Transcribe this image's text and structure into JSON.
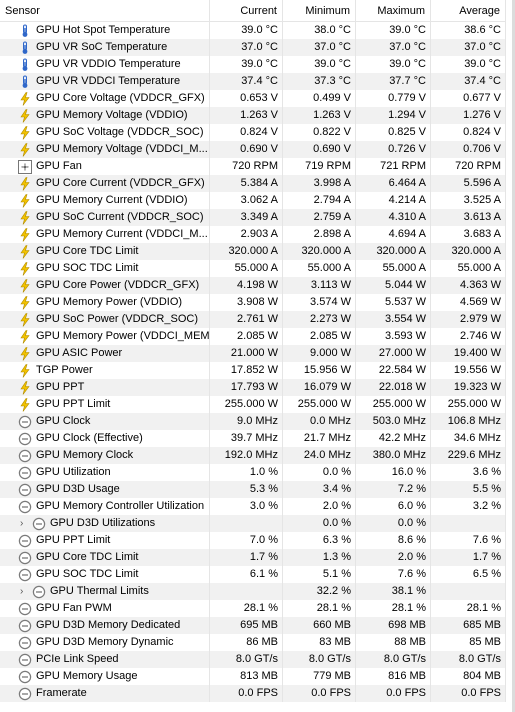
{
  "header": {
    "sensor": "Sensor",
    "current": "Current",
    "minimum": "Minimum",
    "maximum": "Maximum",
    "average": "Average"
  },
  "rows": [
    {
      "name": "GPU Hot Spot Temperature",
      "icon": "thermometer-icon",
      "current": "39.0 °C",
      "min": "38.0 °C",
      "max": "39.0 °C",
      "avg": "38.6 °C"
    },
    {
      "name": "GPU VR SoC Temperature",
      "icon": "thermometer-icon",
      "current": "37.0 °C",
      "min": "37.0 °C",
      "max": "37.0 °C",
      "avg": "37.0 °C"
    },
    {
      "name": "GPU VR VDDIO Temperature",
      "icon": "thermometer-icon",
      "current": "39.0 °C",
      "min": "39.0 °C",
      "max": "39.0 °C",
      "avg": "39.0 °C"
    },
    {
      "name": "GPU VR VDDCI Temperature",
      "icon": "thermometer-icon",
      "current": "37.4 °C",
      "min": "37.3 °C",
      "max": "37.7 °C",
      "avg": "37.4 °C"
    },
    {
      "name": "GPU Core Voltage (VDDCR_GFX)",
      "icon": "lightning-icon",
      "current": "0.653 V",
      "min": "0.499 V",
      "max": "0.779 V",
      "avg": "0.677 V"
    },
    {
      "name": "GPU Memory Voltage (VDDIO)",
      "icon": "lightning-icon",
      "current": "1.263 V",
      "min": "1.263 V",
      "max": "1.294 V",
      "avg": "1.276 V"
    },
    {
      "name": "GPU SoC Voltage (VDDCR_SOC)",
      "icon": "lightning-icon",
      "current": "0.824 V",
      "min": "0.822 V",
      "max": "0.825 V",
      "avg": "0.824 V"
    },
    {
      "name": "GPU Memory Voltage (VDDCI_M...",
      "icon": "lightning-icon",
      "current": "0.690 V",
      "min": "0.690 V",
      "max": "0.726 V",
      "avg": "0.706 V"
    },
    {
      "name": "GPU Fan",
      "icon": "fan-icon",
      "current": "720 RPM",
      "min": "719 RPM",
      "max": "721 RPM",
      "avg": "720 RPM"
    },
    {
      "name": "GPU Core Current (VDDCR_GFX)",
      "icon": "lightning-icon",
      "current": "5.384 A",
      "min": "3.998 A",
      "max": "6.464 A",
      "avg": "5.596 A"
    },
    {
      "name": "GPU Memory Current (VDDIO)",
      "icon": "lightning-icon",
      "current": "3.062 A",
      "min": "2.794 A",
      "max": "4.214 A",
      "avg": "3.525 A"
    },
    {
      "name": "GPU SoC Current (VDDCR_SOC)",
      "icon": "lightning-icon",
      "current": "3.349 A",
      "min": "2.759 A",
      "max": "4.310 A",
      "avg": "3.613 A"
    },
    {
      "name": "GPU Memory Current (VDDCI_M...",
      "icon": "lightning-icon",
      "current": "2.903 A",
      "min": "2.898 A",
      "max": "4.694 A",
      "avg": "3.683 A"
    },
    {
      "name": "GPU Core TDC Limit",
      "icon": "lightning-icon",
      "current": "320.000 A",
      "min": "320.000 A",
      "max": "320.000 A",
      "avg": "320.000 A"
    },
    {
      "name": "GPU SOC TDC Limit",
      "icon": "lightning-icon",
      "current": "55.000 A",
      "min": "55.000 A",
      "max": "55.000 A",
      "avg": "55.000 A"
    },
    {
      "name": "GPU Core Power (VDDCR_GFX)",
      "icon": "lightning-icon",
      "current": "4.198 W",
      "min": "3.113 W",
      "max": "5.044 W",
      "avg": "4.363 W"
    },
    {
      "name": "GPU Memory Power (VDDIO)",
      "icon": "lightning-icon",
      "current": "3.908 W",
      "min": "3.574 W",
      "max": "5.537 W",
      "avg": "4.569 W"
    },
    {
      "name": "GPU SoC Power (VDDCR_SOC)",
      "icon": "lightning-icon",
      "current": "2.761 W",
      "min": "2.273 W",
      "max": "3.554 W",
      "avg": "2.979 W"
    },
    {
      "name": "GPU Memory Power (VDDCI_MEM)",
      "icon": "lightning-icon",
      "current": "2.085 W",
      "min": "2.085 W",
      "max": "3.593 W",
      "avg": "2.746 W"
    },
    {
      "name": "GPU ASIC Power",
      "icon": "lightning-icon",
      "current": "21.000 W",
      "min": "9.000 W",
      "max": "27.000 W",
      "avg": "19.400 W"
    },
    {
      "name": "TGP Power",
      "icon": "lightning-icon",
      "current": "17.852 W",
      "min": "15.956 W",
      "max": "22.584 W",
      "avg": "19.556 W"
    },
    {
      "name": "GPU PPT",
      "icon": "lightning-icon",
      "current": "17.793 W",
      "min": "16.079 W",
      "max": "22.018 W",
      "avg": "19.323 W"
    },
    {
      "name": "GPU PPT Limit",
      "icon": "lightning-icon",
      "current": "255.000 W",
      "min": "255.000 W",
      "max": "255.000 W",
      "avg": "255.000 W"
    },
    {
      "name": "GPU Clock",
      "icon": "clock-icon",
      "current": "9.0 MHz",
      "min": "0.0 MHz",
      "max": "503.0 MHz",
      "avg": "106.8 MHz"
    },
    {
      "name": "GPU Clock (Effective)",
      "icon": "clock-icon",
      "current": "39.7 MHz",
      "min": "21.7 MHz",
      "max": "42.2 MHz",
      "avg": "34.6 MHz"
    },
    {
      "name": "GPU Memory Clock",
      "icon": "clock-icon",
      "current": "192.0 MHz",
      "min": "24.0 MHz",
      "max": "380.0 MHz",
      "avg": "229.6 MHz"
    },
    {
      "name": "GPU Utilization",
      "icon": "clock-icon",
      "current": "1.0 %",
      "min": "0.0 %",
      "max": "16.0 %",
      "avg": "3.6 %"
    },
    {
      "name": "GPU D3D Usage",
      "icon": "clock-icon",
      "current": "5.3 %",
      "min": "3.4 %",
      "max": "7.2 %",
      "avg": "5.5 %"
    },
    {
      "name": "GPU Memory Controller Utilization",
      "icon": "clock-icon",
      "current": "3.0 %",
      "min": "2.0 %",
      "max": "6.0 %",
      "avg": "3.2 %"
    },
    {
      "name": "GPU D3D Utilizations",
      "icon": "clock-icon",
      "expandable": true,
      "current": "",
      "min": "0.0 %",
      "max": "0.0 %",
      "avg": ""
    },
    {
      "name": "GPU PPT Limit",
      "icon": "clock-icon",
      "current": "7.0 %",
      "min": "6.3 %",
      "max": "8.6 %",
      "avg": "7.6 %"
    },
    {
      "name": "GPU Core TDC Limit",
      "icon": "clock-icon",
      "current": "1.7 %",
      "min": "1.3 %",
      "max": "2.0 %",
      "avg": "1.7 %"
    },
    {
      "name": "GPU SOC TDC Limit",
      "icon": "clock-icon",
      "current": "6.1 %",
      "min": "5.1 %",
      "max": "7.6 %",
      "avg": "6.5 %"
    },
    {
      "name": "GPU Thermal Limits",
      "icon": "clock-icon",
      "expandable": true,
      "current": "",
      "min": "32.2 %",
      "max": "38.1 %",
      "avg": ""
    },
    {
      "name": "GPU Fan PWM",
      "icon": "clock-icon",
      "current": "28.1 %",
      "min": "28.1 %",
      "max": "28.1 %",
      "avg": "28.1 %"
    },
    {
      "name": "GPU D3D Memory Dedicated",
      "icon": "clock-icon",
      "current": "695 MB",
      "min": "660 MB",
      "max": "698 MB",
      "avg": "685 MB"
    },
    {
      "name": "GPU D3D Memory Dynamic",
      "icon": "clock-icon",
      "current": "86 MB",
      "min": "83 MB",
      "max": "88 MB",
      "avg": "85 MB"
    },
    {
      "name": "PCIe Link Speed",
      "icon": "clock-icon",
      "current": "8.0 GT/s",
      "min": "8.0 GT/s",
      "max": "8.0 GT/s",
      "avg": "8.0 GT/s"
    },
    {
      "name": "GPU Memory Usage",
      "icon": "clock-icon",
      "current": "813 MB",
      "min": "779 MB",
      "max": "816 MB",
      "avg": "804 MB"
    },
    {
      "name": "Framerate",
      "icon": "clock-icon",
      "current": "0.0 FPS",
      "min": "0.0 FPS",
      "max": "0.0 FPS",
      "avg": "0.0 FPS"
    }
  ],
  "colors": {
    "shade": "#f1f1f1",
    "grid": "#e5e5e5",
    "thermometer": "#2f67c9",
    "lightning": "#f2c200",
    "clock": "#7a7a7a"
  }
}
